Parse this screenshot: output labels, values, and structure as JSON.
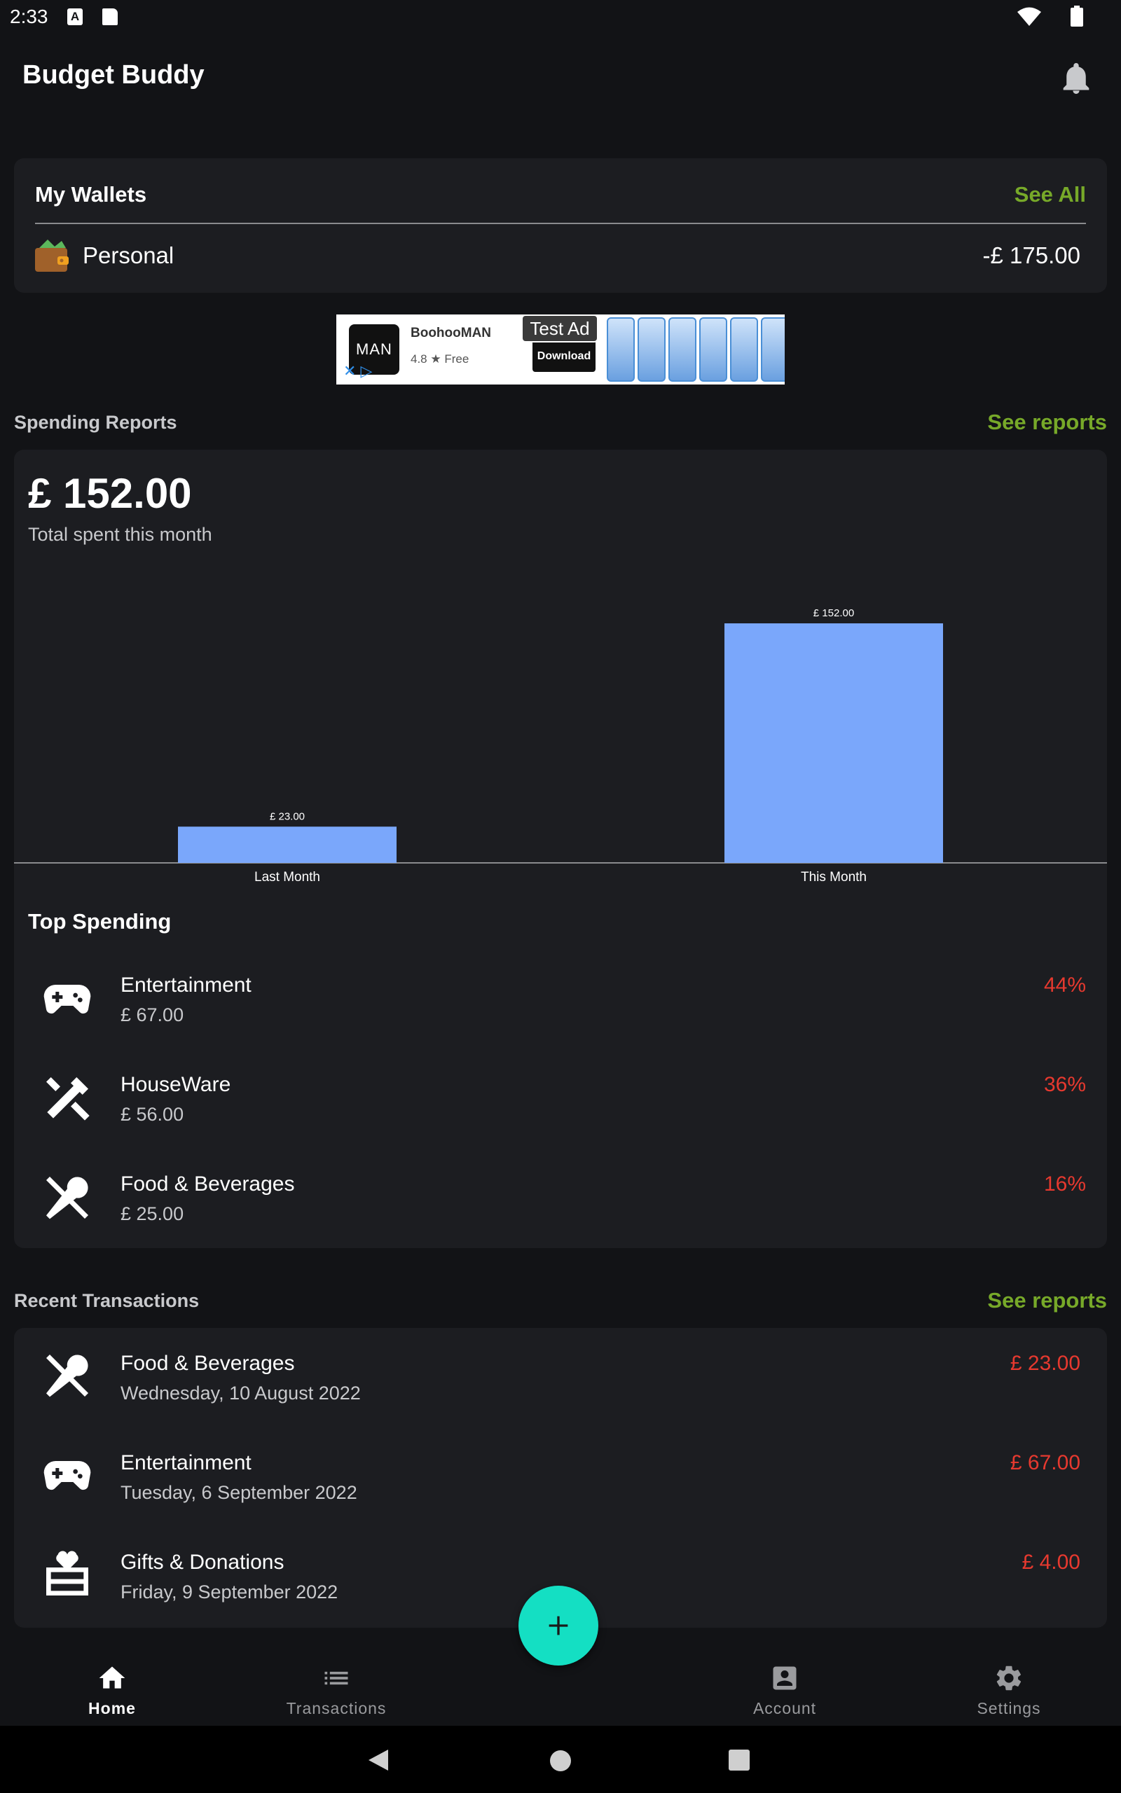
{
  "status_bar": {
    "time": "2:33",
    "a_badge": "A"
  },
  "app_bar": {
    "title": "Budget Buddy",
    "icon": "bell-icon"
  },
  "wallets": {
    "title": "My Wallets",
    "see_all": "See All",
    "items": [
      {
        "name": "Personal",
        "amount": "-£ 175.00",
        "icon": "wallet-icon"
      }
    ]
  },
  "ad": {
    "logo": "MAN",
    "app_name": "BoohooMAN",
    "rating": "4.8 ★ Free",
    "download": "Download",
    "test_label": "Test Ad"
  },
  "spending_reports": {
    "title": "Spending Reports",
    "link": "See reports",
    "total": "£ 152.00",
    "total_label": "Total spent this month",
    "top_spending_title": "Top Spending",
    "top_spending": [
      {
        "name": "Entertainment",
        "amount": "£ 67.00",
        "percent": "44%",
        "icon": "gamepad-icon"
      },
      {
        "name": "HouseWare",
        "amount": "£ 56.00",
        "percent": "36%",
        "icon": "tools-icon"
      },
      {
        "name": "Food & Beverages",
        "amount": "£ 25.00",
        "percent": "16%",
        "icon": "utensils-icon"
      }
    ]
  },
  "chart_data": {
    "type": "bar",
    "categories": [
      "Last Month",
      "This Month"
    ],
    "values": [
      23,
      152
    ],
    "data_labels": [
      "£ 23.00",
      "£ 152.00"
    ],
    "bar_color": "#7aa7fb",
    "ylim": [
      0,
      160
    ],
    "grid": false
  },
  "recent_transactions": {
    "title": "Recent Transactions",
    "link": "See reports",
    "items": [
      {
        "name": "Food & Beverages",
        "date": "Wednesday, 10 August 2022",
        "amount": "£ 23.00",
        "icon": "utensils-icon"
      },
      {
        "name": "Entertainment",
        "date": "Tuesday, 6 September 2022",
        "amount": "£ 67.00",
        "icon": "gamepad-icon"
      },
      {
        "name": "Gifts & Donations",
        "date": "Friday, 9 September 2022",
        "amount": "£ 4.00",
        "icon": "gift-icon"
      }
    ]
  },
  "fab": {
    "icon": "plus-icon"
  },
  "bottom_nav": [
    {
      "label": "Home",
      "icon": "home-icon",
      "active": true
    },
    {
      "label": "Transactions",
      "icon": "list-icon",
      "active": false
    },
    {
      "label": "Account",
      "icon": "account-icon",
      "active": false
    },
    {
      "label": "Settings",
      "icon": "gear-icon",
      "active": false
    }
  ],
  "colors": {
    "accent_green": "#77a929",
    "negative_red": "#e6392f",
    "fab_teal": "#14dfc3",
    "card_bg": "#1c1d21",
    "page_bg": "#121316"
  }
}
